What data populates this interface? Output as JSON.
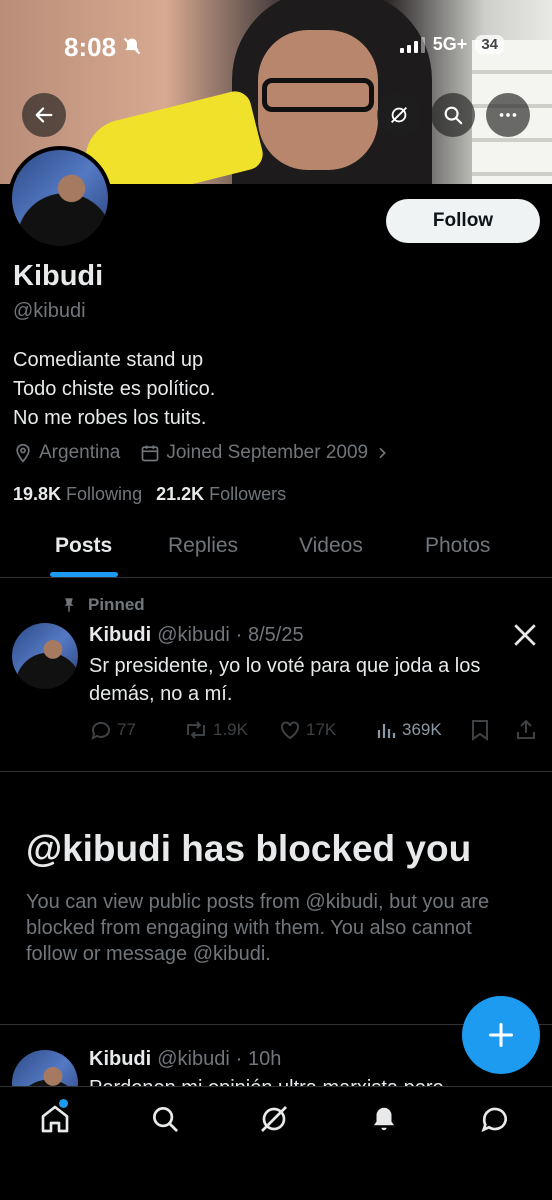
{
  "status_bar": {
    "time": "8:08",
    "network": "5G+",
    "battery": "34"
  },
  "profile": {
    "name": "Kibudi",
    "handle": "@kibudi",
    "follow_label": "Follow",
    "bio": [
      "Comediante stand up",
      "Todo chiste es político.",
      "No me robes los tuits."
    ],
    "location": "Argentina",
    "joined": "Joined September 2009",
    "following_count": "19.8K",
    "following_label": "Following",
    "followers_count": "21.2K",
    "followers_label": "Followers"
  },
  "tabs": [
    {
      "label": "Posts",
      "active": true
    },
    {
      "label": "Replies",
      "active": false
    },
    {
      "label": "Videos",
      "active": false
    },
    {
      "label": "Photos",
      "active": false
    }
  ],
  "pinned_post": {
    "pinned_label": "Pinned",
    "author": "Kibudi",
    "handle": "@kibudi",
    "date": "· 8/5/25",
    "text": "Sr presidente, yo lo voté para que joda a los demás, no a mí.",
    "replies": "77",
    "reposts": "1.9K",
    "likes": "17K",
    "views": "369K"
  },
  "blocked": {
    "title": "@kibudi has blocked you",
    "text": "You can view public posts from @kibudi, but you are blocked from engaging with them. You also cannot follow or message @kibudi."
  },
  "next_post": {
    "author": "Kibudi",
    "handle": "@kibudi",
    "time": "· 10h",
    "text_partial": "Perdonen mi opinión ultra marxista pero"
  },
  "icons": {
    "back": "back-arrow-icon",
    "grok": "grok-icon",
    "search": "search-icon",
    "more": "more-icon",
    "location": "location-pin-icon",
    "calendar": "calendar-icon",
    "pin": "pin-icon",
    "x_logo": "x-logo-icon",
    "compose": "plus-icon"
  },
  "colors": {
    "accent": "#1d9bf0",
    "background": "#000000",
    "muted": "#71767b"
  }
}
